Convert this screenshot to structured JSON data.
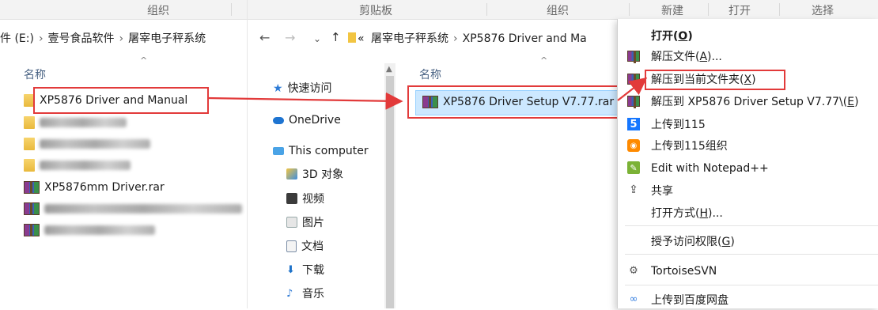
{
  "ribbon": {
    "groups": [
      "组织",
      "剪贴板",
      "组织",
      "新建",
      "打开",
      "选择"
    ]
  },
  "left_pane": {
    "breadcrumb": [
      "件 (E:)",
      "壹号食品软件",
      "屠宰电子秤系统"
    ],
    "column_header": "名称",
    "items": [
      {
        "name": "XP5876 Driver and Manual",
        "type": "folder"
      },
      {
        "name": "",
        "type": "folder"
      },
      {
        "name": "",
        "type": "folder"
      },
      {
        "name": "",
        "type": "folder"
      },
      {
        "name": "XP5876mm Driver.rar",
        "type": "rar"
      },
      {
        "name": "",
        "type": "rar"
      },
      {
        "name": "",
        "type": "rar"
      }
    ]
  },
  "middle": {
    "breadcrumb": [
      "«",
      "屠宰电子秤系统",
      "XP5876 Driver and Ma"
    ],
    "column_header": "名称",
    "nav": [
      {
        "label": "快速访问",
        "icon": "star-icon"
      },
      {
        "label": "OneDrive",
        "icon": "cloud-icon"
      },
      {
        "label": "This computer",
        "icon": "computer-icon"
      },
      {
        "label": "3D 对象",
        "icon": "3d-objects-icon"
      },
      {
        "label": "视频",
        "icon": "video-icon"
      },
      {
        "label": "图片",
        "icon": "pictures-icon"
      },
      {
        "label": "文档",
        "icon": "documents-icon"
      },
      {
        "label": "下载",
        "icon": "download-icon"
      },
      {
        "label": "音乐",
        "icon": "music-icon"
      }
    ],
    "selected_file": "XP5876 Driver Setup V7.77.rar"
  },
  "context_menu": {
    "open": "打开(O)",
    "extract_files": "解压文件(A)...",
    "extract_here": "解压到当前文件夹(X)",
    "extract_to": "解压到 XP5876 Driver Setup V7.77\\(E)",
    "upload_115": "上传到115",
    "upload_115_org": "上传到115组织",
    "edit_notepad": "Edit with Notepad++",
    "share": "共享",
    "open_with": "打开方式(H)...",
    "grant_access": "授予访问权限(G)",
    "tortoise": "TortoiseSVN",
    "upload_baidu": "上传到百度网盘"
  },
  "colors": {
    "highlight_red": "#e23a3a",
    "selection_blue": "#cce8ff"
  }
}
